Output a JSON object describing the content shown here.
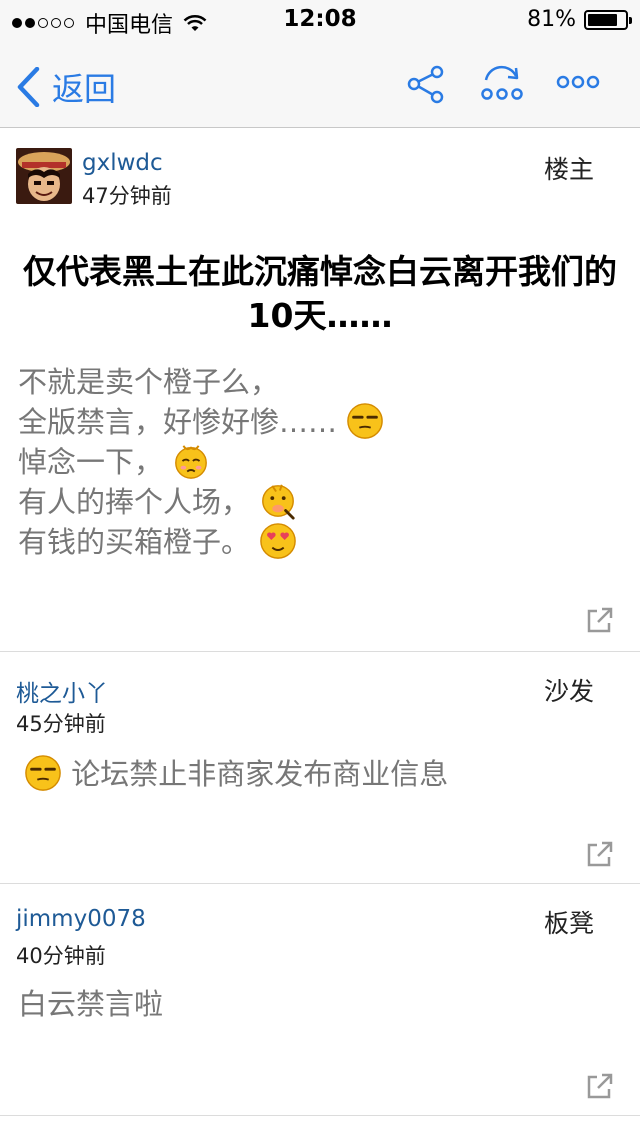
{
  "status_bar": {
    "carrier": "中国电信",
    "time": "12:08",
    "battery": "81%",
    "battery_level": 0.81
  },
  "nav": {
    "back_label": "返回",
    "icons": [
      "share-icon",
      "refresh-icon",
      "more-icon"
    ]
  },
  "posts": [
    {
      "username": "gxlwdc",
      "time": "47分钟前",
      "floor": "楼主",
      "title": "仅代表黑土在此沉痛悼念白云离开我们的10天……",
      "lines": [
        "不就是卖个橙子么，",
        "全版禁言，好惨好惨……",
        "悼念一下，",
        "有人的捧个人场，",
        "有钱的买箱橙子。"
      ]
    },
    {
      "username": "桃之小丫",
      "time": "45分钟前",
      "floor": "沙发",
      "text": "论坛禁止非商家发布商业信息"
    },
    {
      "username": "jimmy0078",
      "time": "40分钟前",
      "floor": "板凳",
      "text": "白云禁言啦"
    }
  ],
  "colors": {
    "accent": "#2a7be4",
    "username": "#1e5a96",
    "body_text": "#777777"
  }
}
